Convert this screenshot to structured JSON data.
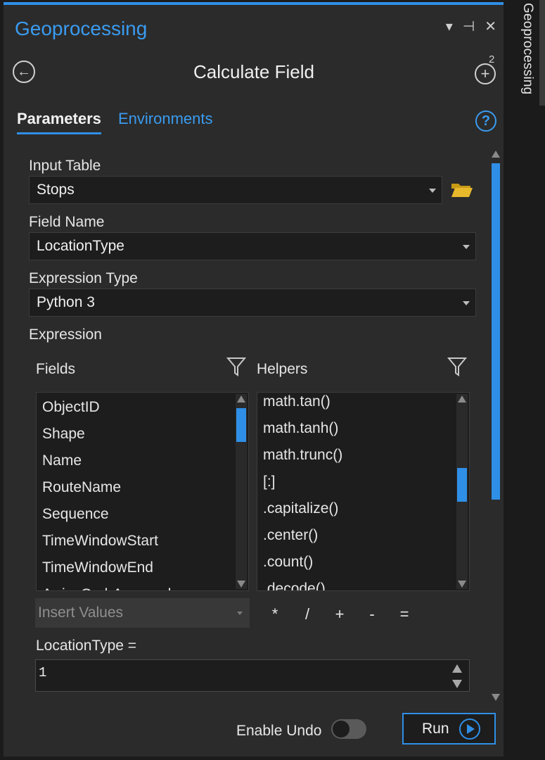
{
  "side_tab": {
    "label": "Geoprocessing"
  },
  "pane": {
    "title": "Geoprocessing",
    "controls": {
      "menu": "▾",
      "pin": "⊣",
      "close": "✕"
    }
  },
  "tool": {
    "title": "Calculate Field",
    "add_badge": "2"
  },
  "tabs": {
    "parameters": "Parameters",
    "environments": "Environments"
  },
  "help": "?",
  "params": {
    "input_table": {
      "label": "Input Table",
      "value": "Stops"
    },
    "field_name": {
      "label": "Field Name",
      "value": "LocationType"
    },
    "expression_type": {
      "label": "Expression Type",
      "value": "Python 3"
    },
    "expression": {
      "label": "Expression"
    }
  },
  "fields": {
    "label": "Fields",
    "items": [
      "ObjectID",
      "Shape",
      "Name",
      "RouteName",
      "Sequence",
      "TimeWindowStart",
      "TimeWindowEnd",
      "ArriveCurbApproach"
    ]
  },
  "helpers": {
    "label": "Helpers",
    "items": [
      "math.tan()",
      "math.tanh()",
      "math.trunc()",
      "[:]",
      ".capitalize()",
      ".center()",
      ".count()",
      ".decode()"
    ]
  },
  "insert_values": {
    "placeholder": "Insert Values"
  },
  "operators": [
    "*",
    "/",
    "+",
    "-",
    "="
  ],
  "expression_target": "LocationType =",
  "expression_value": "1",
  "footer": {
    "enable_undo_label": "Enable Undo",
    "enable_undo": false,
    "run_label": "Run"
  },
  "colors": {
    "accent": "#2f8fe6",
    "link": "#3a9bf0",
    "folder": "#e8b92b"
  }
}
